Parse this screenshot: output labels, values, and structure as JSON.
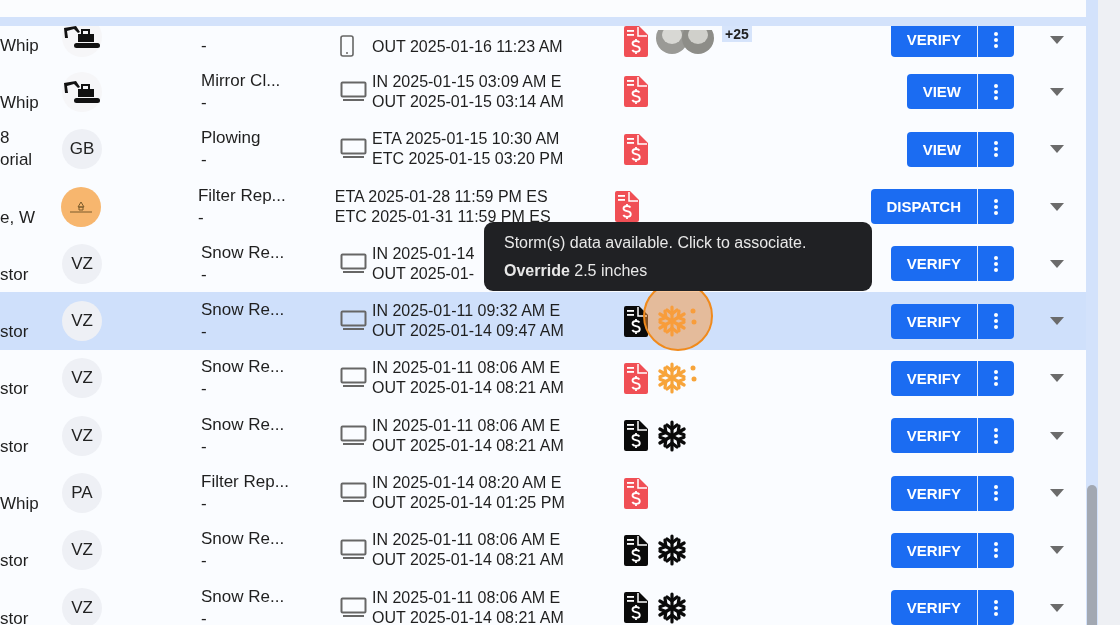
{
  "rows": [
    {
      "cut_top": true,
      "selected": false,
      "customer": [
        "Whip"
      ],
      "avatar": {
        "kind": "excavator"
      },
      "service": [],
      "subline": "-",
      "device": {
        "kind": "phone"
      },
      "times": [
        "OUT 2025-01-16 11:23 AM"
      ],
      "invoice": {
        "paid": false
      },
      "photos": {
        "badge": "+25"
      },
      "action": "VERIFY"
    },
    {
      "cut_top": false,
      "selected": false,
      "customer": [
        "Whip"
      ],
      "avatar": {
        "kind": "excavator"
      },
      "service": [
        "Mirror Cl..."
      ],
      "subline": "-",
      "device": {
        "kind": "desktop"
      },
      "times": [
        "IN 2025-01-15 03:09 AM E",
        "OUT 2025-01-15 03:14 AM"
      ],
      "invoice": {
        "paid": false
      },
      "action": "VIEW"
    },
    {
      "cut_top": false,
      "selected": false,
      "customer": [
        "8",
        "orial"
      ],
      "avatar": {
        "kind": "initials",
        "text": "GB"
      },
      "service": [
        "Plowing"
      ],
      "subline": "-",
      "device": {
        "kind": "desktop"
      },
      "times": [
        "ETA 2025-01-15 10:30 AM",
        "ETC 2025-01-15 03:20 PM"
      ],
      "invoice": {
        "paid": false
      },
      "action": "VIEW"
    },
    {
      "cut_top": false,
      "selected": false,
      "customer": [
        "e, W"
      ],
      "avatar": {
        "kind": "logo"
      },
      "service": [
        "Filter Rep..."
      ],
      "subline": "-",
      "times": [
        "ETA 2025-01-28 11:59 PM ES",
        "ETC 2025-01-31 11:59 PM ES"
      ],
      "invoice": {
        "paid": false
      },
      "action": "DISPATCH"
    },
    {
      "cut_top": false,
      "selected": false,
      "customer": [
        "stor"
      ],
      "avatar": {
        "kind": "initials",
        "text": "VZ"
      },
      "service": [
        "Snow Re..."
      ],
      "subline": "-",
      "device": {
        "kind": "desktop"
      },
      "times": [
        "IN 2025-01-14",
        "OUT 2025-01-"
      ],
      "action": "VERIFY"
    },
    {
      "cut_top": false,
      "selected": true,
      "customer": [
        "stor"
      ],
      "avatar": {
        "kind": "initials",
        "text": "VZ"
      },
      "service": [
        "Snow Re..."
      ],
      "subline": "-",
      "device": {
        "kind": "desktop"
      },
      "times": [
        "IN 2025-01-11 09:32 AM E",
        "OUT 2025-01-14 09:47 AM"
      ],
      "invoice": {
        "paid": true
      },
      "storm": {
        "associated": false
      },
      "action": "VERIFY"
    },
    {
      "cut_top": false,
      "selected": false,
      "customer": [
        "stor"
      ],
      "avatar": {
        "kind": "initials",
        "text": "VZ"
      },
      "service": [
        "Snow Re..."
      ],
      "subline": "-",
      "device": {
        "kind": "desktop"
      },
      "times": [
        "IN 2025-01-11 08:06 AM E",
        "OUT 2025-01-14 08:21 AM"
      ],
      "invoice": {
        "paid": false
      },
      "storm": {
        "associated": false
      },
      "action": "VERIFY"
    },
    {
      "cut_top": false,
      "selected": false,
      "customer": [
        "stor"
      ],
      "avatar": {
        "kind": "initials",
        "text": "VZ"
      },
      "service": [
        "Snow Re..."
      ],
      "subline": "-",
      "device": {
        "kind": "desktop"
      },
      "times": [
        "IN 2025-01-11 08:06 AM E",
        "OUT 2025-01-14 08:21 AM"
      ],
      "invoice": {
        "paid": true
      },
      "storm": {
        "associated": true
      },
      "action": "VERIFY"
    },
    {
      "cut_top": false,
      "selected": false,
      "customer": [
        "Whip"
      ],
      "avatar": {
        "kind": "initials",
        "text": "PA"
      },
      "service": [
        "Filter Rep..."
      ],
      "subline": "-",
      "device": {
        "kind": "desktop"
      },
      "times": [
        "IN 2025-01-14 08:20 AM E",
        "OUT 2025-01-14 01:25 PM"
      ],
      "invoice": {
        "paid": false
      },
      "action": "VERIFY"
    },
    {
      "cut_top": false,
      "selected": false,
      "customer": [
        "stor"
      ],
      "avatar": {
        "kind": "initials",
        "text": "VZ"
      },
      "service": [
        "Snow Re..."
      ],
      "subline": "-",
      "device": {
        "kind": "desktop"
      },
      "times": [
        "IN 2025-01-11 08:06 AM E",
        "OUT 2025-01-14 08:21 AM"
      ],
      "invoice": {
        "paid": true
      },
      "storm": {
        "associated": true
      },
      "action": "VERIFY"
    },
    {
      "cut_top": false,
      "selected": false,
      "customer": [
        "stor"
      ],
      "avatar": {
        "kind": "initials",
        "text": "VZ"
      },
      "service": [
        "Snow Re..."
      ],
      "subline": "-",
      "device": {
        "kind": "desktop"
      },
      "times": [
        "IN 2025-01-11 08:06 AM E",
        "OUT 2025-01-14 08:21 AM"
      ],
      "invoice": {
        "paid": true
      },
      "storm": {
        "associated": true
      },
      "action": "VERIFY"
    }
  ],
  "tooltip": {
    "text": "Storm(s) data available. Click to associate.",
    "detail": "**Override** 2.5 inches"
  }
}
